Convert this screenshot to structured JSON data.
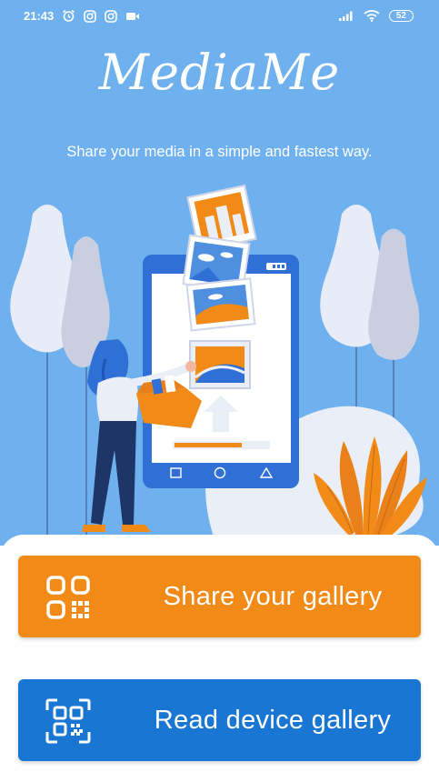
{
  "status_bar": {
    "time": "21:43",
    "left_icons": [
      "alarm-icon",
      "instagram-icon",
      "instagram-icon",
      "video-camera-icon"
    ],
    "right_icons": [
      "signal-icon",
      "wifi-icon",
      "battery-icon"
    ],
    "battery_level": "52"
  },
  "app": {
    "title": "MediaMe",
    "tagline": "Share your media in a simple and fastest way."
  },
  "actions": {
    "share_label": "Share your gallery",
    "share_icon": "qr-code-icon",
    "read_label": "Read device gallery",
    "read_icon": "qr-scan-icon"
  },
  "colors": {
    "background": "#6fb1ee",
    "share_button": "#f28a17",
    "read_button": "#1976d2",
    "phone_frame": "#2f6fd6"
  }
}
